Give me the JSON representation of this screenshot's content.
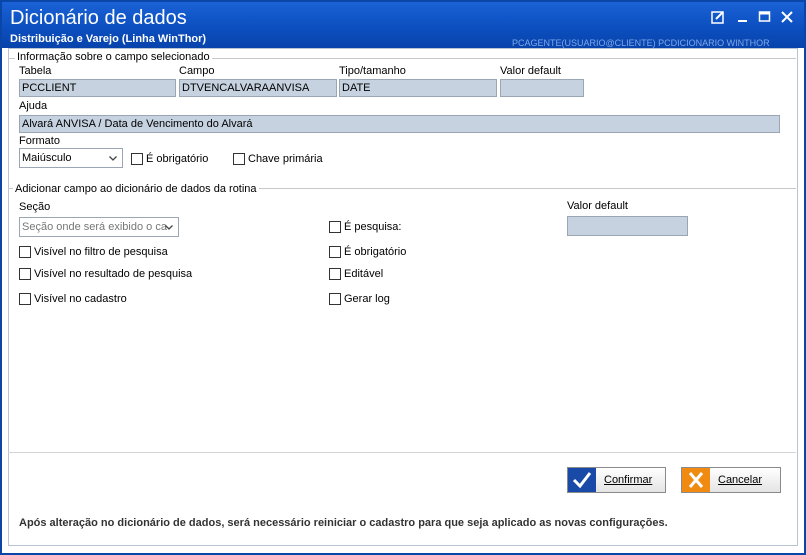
{
  "window": {
    "title": "Dicionário de dados",
    "subtitle": "Distribuição e Varejo (Linha WinThor)",
    "bg_text": "PCAGENTE(USUARIO@CLIENTE) PCDICIONARIO WINTHOR"
  },
  "selected_field": {
    "group_label": "Informação sobre o campo selecionado",
    "tabela_label": "Tabela",
    "tabela_value": "PCCLIENT",
    "campo_label": "Campo",
    "campo_value": "DTVENCALVARAANVISA",
    "tipo_label": "Tipo/tamanho",
    "tipo_value": "DATE",
    "valor_default_label": "Valor default",
    "valor_default_value": "",
    "ajuda_label": "Ajuda",
    "ajuda_value": "Alvará ANVISA / Data  de Vencimento do Alvará",
    "formato_label": "Formato",
    "formato_value": "Maiúsculo",
    "obrigatorio_label": "É obrigatório",
    "chave_label": "Chave primária"
  },
  "add_field": {
    "group_label": "Adicionar campo ao dicionário de dados da rotina",
    "secao_label": "Seção",
    "secao_placeholder": "Seção onde será exibido o ca",
    "valor_default_label": "Valor default",
    "visivel_filtro_label": "Visível no filtro de pesquisa",
    "visivel_resultado_label": "Visível no resultado de pesquisa",
    "visivel_cadastro_label": "Visível no cadastro",
    "e_pesquisa_label": "É pesquisa:",
    "e_obrigatorio_label": "É obrigatório",
    "editavel_label": "Editável",
    "gerar_log_label": "Gerar log"
  },
  "buttons": {
    "confirmar": "Confirmar",
    "cancelar": "Cancelar"
  },
  "footer": "Após alteração no dicionário de dados, será necessário reiniciar o cadastro para que seja aplicado as novas configurações.",
  "colors": {
    "titlebar": "#0c4fc0",
    "field_bg": "#c6d2e0",
    "confirm_icon": "#1a4aa8",
    "cancel_icon": "#f08a10"
  }
}
